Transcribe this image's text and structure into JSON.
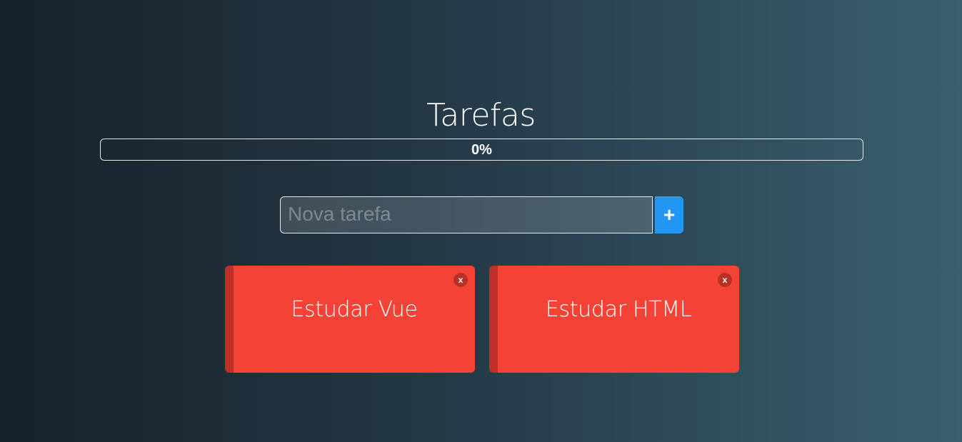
{
  "app": {
    "title": "Tarefas"
  },
  "progress": {
    "value": 0,
    "label": "0%"
  },
  "new_task": {
    "placeholder": "Nova tarefa",
    "value": "",
    "add_label": "+"
  },
  "tasks": [
    {
      "label": "Estudar Vue",
      "close_label": "x",
      "status": "pending"
    },
    {
      "label": "Estudar HTML",
      "close_label": "x",
      "status": "pending"
    }
  ],
  "colors": {
    "background_start": "#172129",
    "background_end": "#3a5f70",
    "task_pending": "#f44336",
    "task_pending_stripe": "#c0302a",
    "add_button": "#2196f3",
    "close_button": "#b83128"
  },
  "icons": {
    "add": "plus-icon",
    "remove": "close-icon"
  }
}
